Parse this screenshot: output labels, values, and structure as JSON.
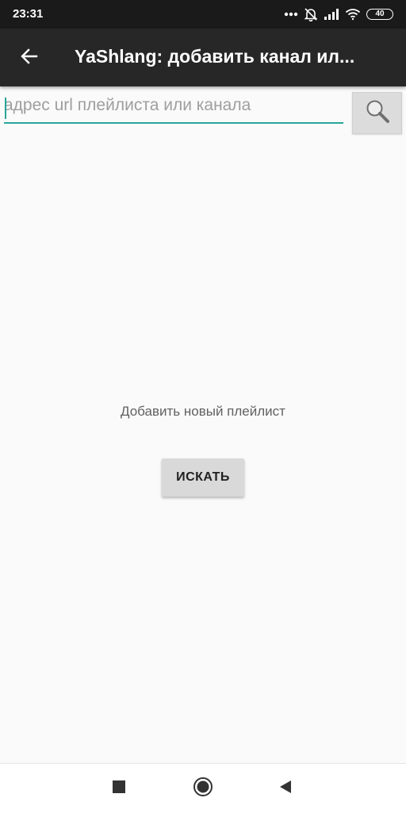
{
  "status_bar": {
    "time": "23:31",
    "battery_level": "40",
    "icons": [
      "more-dots-icon",
      "notifications-off-icon",
      "signal-icon",
      "wifi-icon",
      "battery-icon"
    ]
  },
  "app_bar": {
    "title": "YaShlang: добавить канал ил...",
    "back_icon": "arrow-back-icon"
  },
  "search": {
    "value": "",
    "placeholder": "адрес url плейлиста или канала",
    "button_icon": "search-icon"
  },
  "main": {
    "empty_message": "Добавить новый плейлист",
    "action_button_label": "ИСКАТЬ"
  },
  "nav_bar": {
    "buttons": [
      "recents-square-icon",
      "home-circle-icon",
      "back-triangle-icon"
    ]
  },
  "colors": {
    "accent": "#26a69a",
    "app_bar": "#272727",
    "status_bar": "#1a1a1a",
    "background": "#fafafa"
  }
}
